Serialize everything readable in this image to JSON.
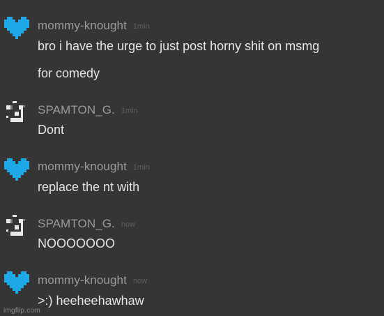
{
  "messages": [
    {
      "author": "mommy-knought",
      "avatar_icon": "blue-pixel-heart-icon",
      "timestamp": "1min",
      "lines": [
        "bro i have the urge to just post horny shit on msmg",
        "for comedy"
      ]
    },
    {
      "author": "SPAMTON_G.",
      "avatar_icon": "spamton-pixel-face-icon",
      "timestamp": "1min",
      "lines": [
        "Dont"
      ]
    },
    {
      "author": "mommy-knought",
      "avatar_icon": "blue-pixel-heart-icon",
      "timestamp": "1min",
      "lines": [
        "replace the nt with"
      ]
    },
    {
      "author": "SPAMTON_G.",
      "avatar_icon": "spamton-pixel-face-icon",
      "timestamp": "now",
      "lines": [
        "NOOOOOOO"
      ]
    },
    {
      "author": "mommy-knought",
      "avatar_icon": "blue-pixel-heart-icon",
      "timestamp": "now",
      "lines": [
        ">:) heeheehawhaw"
      ]
    }
  ],
  "watermark": "imgflip.com",
  "colors": {
    "background": "#353535",
    "heart": "#1fa8e8",
    "username": "#9a9a9a",
    "timestamp": "#5e5e5e",
    "message_text": "#e4e4e4",
    "spamton_face": "#e8e8e8"
  }
}
